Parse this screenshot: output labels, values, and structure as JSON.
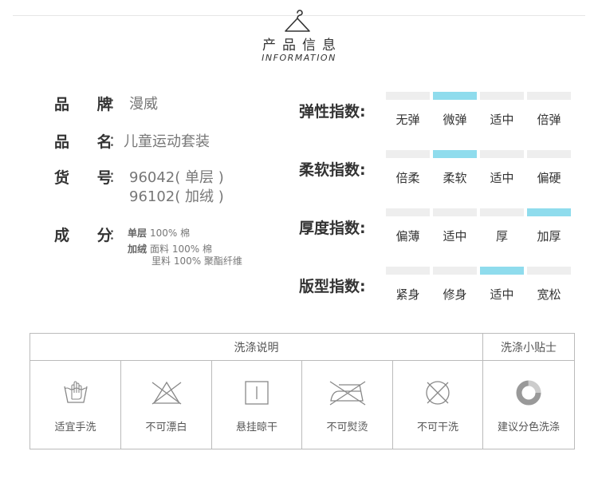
{
  "header": {
    "title": "产品信息",
    "subtitle": "INFORMATION"
  },
  "info": {
    "brand": {
      "label": "品 牌",
      "value": "漫威"
    },
    "name": {
      "label": "品 名",
      "value": "儿童运动套装"
    },
    "item_no": {
      "label": "货 号",
      "values": [
        "96042( 单层 )",
        "96102( 加绒 )"
      ]
    },
    "composition": {
      "label": "成 分",
      "single_type": "单层",
      "single_detail": "100% 棉",
      "fleece_type": "加绒",
      "fleece_face": "面料 100% 棉",
      "fleece_lining": "里料 100% 聚酯纤维"
    },
    "colon": "："
  },
  "indices": [
    {
      "label": "弹性指数:",
      "options": [
        "无弹",
        "微弹",
        "适中",
        "倍弹"
      ],
      "selected_index": 1
    },
    {
      "label": "柔软指数:",
      "options": [
        "倍柔",
        "柔软",
        "适中",
        "偏硬"
      ],
      "selected_index": 1
    },
    {
      "label": "厚度指数:",
      "options": [
        "偏薄",
        "适中",
        "厚",
        "加厚"
      ],
      "selected_index": 3
    },
    {
      "label": "版型指数:",
      "options": [
        "紧身",
        "修身",
        "适中",
        "宽松"
      ],
      "selected_index": 2
    }
  ],
  "care": {
    "title": "洗涤说明",
    "tip_title": "洗涤小贴士",
    "items": [
      {
        "icon": "hand-wash-icon",
        "label": "适宜手洗"
      },
      {
        "icon": "no-bleach-icon",
        "label": "不可漂白"
      },
      {
        "icon": "hang-dry-icon",
        "label": "悬挂晾干"
      },
      {
        "icon": "no-iron-icon",
        "label": "不可熨烫"
      },
      {
        "icon": "no-dry-clean-icon",
        "label": "不可干洗"
      },
      {
        "icon": "color-separate-icon",
        "label": "建议分色洗涤"
      }
    ]
  },
  "colors": {
    "accent": "#8fdced",
    "bar_off": "#eeeeee",
    "border": "#bbbbbb"
  }
}
